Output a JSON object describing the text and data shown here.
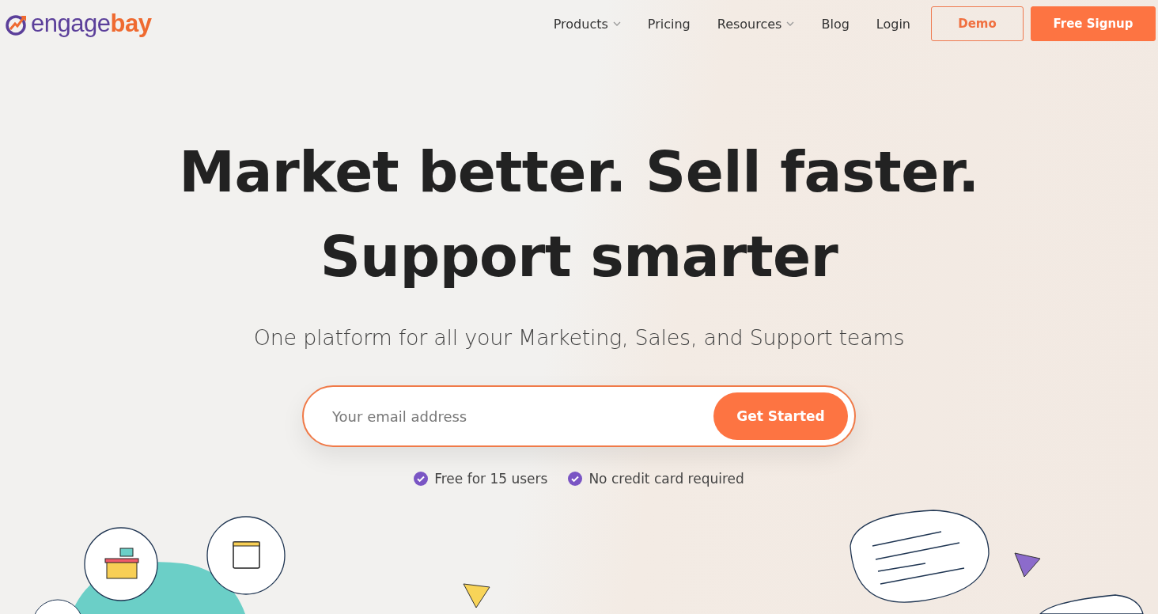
{
  "logo": {
    "primary": "engage",
    "accent": "bay"
  },
  "nav": [
    {
      "label": "Products",
      "has_menu": true
    },
    {
      "label": "Pricing",
      "has_menu": false
    },
    {
      "label": "Resources",
      "has_menu": true
    },
    {
      "label": "Blog",
      "has_menu": false
    },
    {
      "label": "Login",
      "has_menu": false
    }
  ],
  "buttons": [
    {
      "label": "Demo",
      "kind": "outline"
    },
    {
      "label": "Free Signup",
      "kind": "filled"
    }
  ],
  "hero": {
    "headline": [
      "Market better. Sell faster.",
      "Support smarter"
    ],
    "subtitle": "One platform for all your Marketing, Sales, and Support teams"
  },
  "signup": {
    "placeholder": "Your email address",
    "button": "Get Started"
  },
  "benefits": [
    "Free for 15 users",
    "No credit card required"
  ]
}
